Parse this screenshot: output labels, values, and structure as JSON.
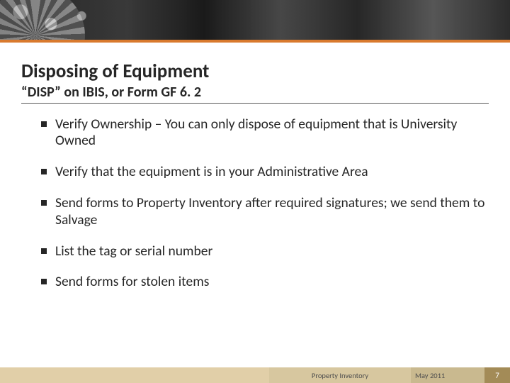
{
  "header": {
    "decorative": true
  },
  "title": "Disposing of Equipment",
  "subtitle": "“DISP” on IBIS, or Form GF 6. 2",
  "bullets": [
    "Verify Ownership – You can only dispose of equipment that is University Owned",
    "Verify that the equipment is in your Administrative Area",
    "Send forms to Property Inventory after required signatures; we send them to Salvage",
    "List the tag or serial number",
    "Send forms for stolen items"
  ],
  "footer": {
    "center_left": "Property Inventory",
    "center_right": "May 2011",
    "page_number": "7"
  }
}
